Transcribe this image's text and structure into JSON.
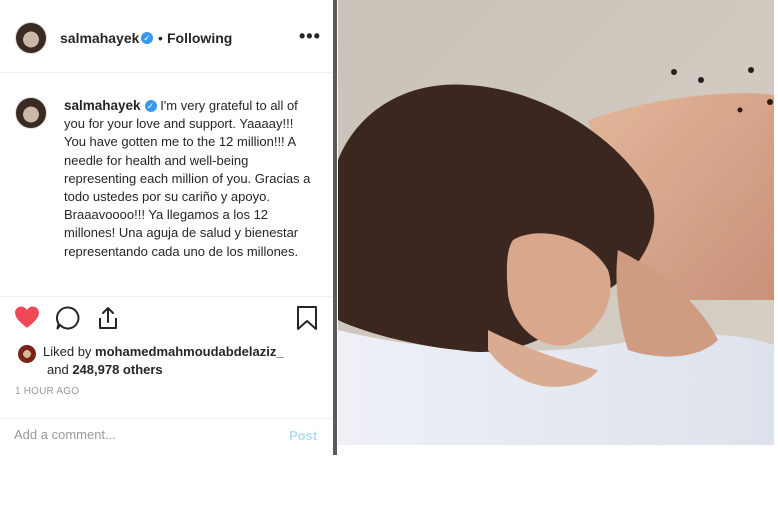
{
  "post": {
    "username": "salmahayek",
    "verified_icon": "verified-badge-icon",
    "separator": "•",
    "follow_status": "Following",
    "more_icon": "more-options-icon",
    "more_label": "•••"
  },
  "caption": {
    "username": "salmahayek",
    "text": "I'm very grateful to all of you for your love and support. Yaaaay!!! You have gotten me to the 12 million!!! A needle for health and well-being representing each million of you. Gracias a todo ustedes por su cariño y apoyo. Braaavoooo!!! Ya llegamos a los 12 millones! Una aguja de salud y bienestar representando cada uno de los millones."
  },
  "actions": {
    "like_icon": "heart-icon",
    "comment_icon": "comment-icon",
    "share_icon": "share-icon",
    "save_icon": "bookmark-icon",
    "liked": true
  },
  "likes": {
    "prefix": "Liked by",
    "user": "mohamedmahmoudabdelaziz_",
    "and": "and",
    "count": "248,978 others"
  },
  "timestamp": "1 HOUR AGO",
  "comment": {
    "placeholder": "Add a comment...",
    "post_label": "Post"
  },
  "colors": {
    "like_red": "#ed4956",
    "verified_blue": "#3897f0",
    "post_button": "#b2dffc"
  }
}
